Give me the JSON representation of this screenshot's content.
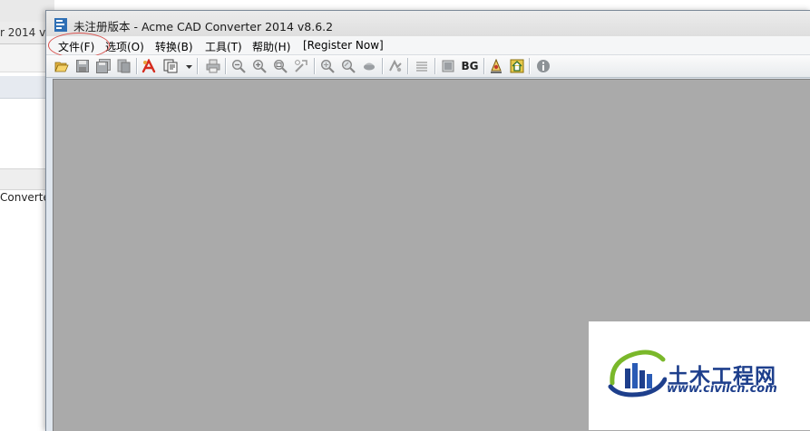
{
  "background_window": {
    "title_fragment": "r 2014 v",
    "text_fragment": "Converte"
  },
  "window": {
    "title": "未注册版本 - Acme CAD Converter 2014 v8.6.2"
  },
  "menu": {
    "items": [
      {
        "label": "文件(F)"
      },
      {
        "label": "选项(O)"
      },
      {
        "label": "转换(B)"
      },
      {
        "label": "工具(T)"
      },
      {
        "label": "帮助(H)"
      },
      {
        "label": "[Register Now]"
      }
    ]
  },
  "toolbar": {
    "bg_label": "BG",
    "icons": [
      "open-folder-icon",
      "save-icon",
      "save-all-icon",
      "print-preview-icon",
      "pdf-convert-icon",
      "batch-convert-icon",
      "dropdown-arrow-icon",
      "print-icon",
      "zoom-out-icon",
      "zoom-in-icon",
      "zoom-window-icon",
      "zoom-realtime-icon",
      "zoom-extents-icon",
      "zoom-previous-icon",
      "pan-icon",
      "layers-icon",
      "plot-styles-icon",
      "bg-color-icon",
      "redline-icon",
      "home-icon",
      "about-icon"
    ]
  },
  "watermark": {
    "name": "土木工程网",
    "url": "www.civilcn.com"
  },
  "colors": {
    "canvas": "#aaaaaa",
    "watermark_text": "#1e3f8c",
    "highlight_circle": "#d9534f"
  }
}
